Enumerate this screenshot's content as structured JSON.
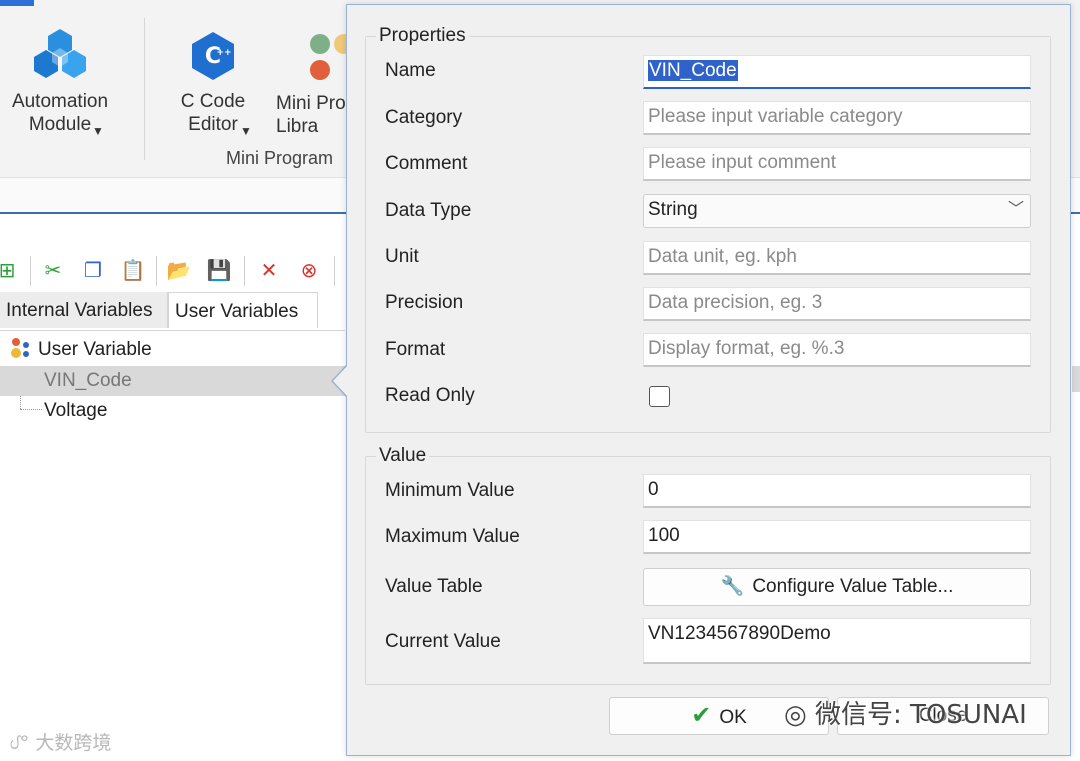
{
  "ribbon": {
    "automation_module_label": "Automation\nModule",
    "c_code_editor_label": "C Code\nEditor",
    "mini_program_library_label": "Mini Pro\nLibra",
    "group_label": "Mini Program",
    "accent_color": "#2f6fd6"
  },
  "toolbar": {
    "icons": [
      "add-icon",
      "cut-icon",
      "copy-icon",
      "paste-icon",
      "import-icon",
      "export-icon",
      "delete-icon",
      "clear-icon"
    ]
  },
  "tabs": [
    {
      "label": "Internal Variables"
    },
    {
      "label": "User Variables"
    }
  ],
  "tree": {
    "root_label": "User Variable",
    "items": [
      {
        "label": "VIN_Code"
      },
      {
        "label": "Voltage"
      }
    ]
  },
  "dialog": {
    "properties_title": "Properties",
    "labels": {
      "name": "Name",
      "category": "Category",
      "comment": "Comment",
      "data_type": "Data Type",
      "unit": "Unit",
      "precision": "Precision",
      "format": "Format",
      "read_only": "Read Only"
    },
    "values": {
      "name": "VIN_Code",
      "data_type": "String"
    },
    "placeholders": {
      "category": "Please input variable category",
      "comment": "Please input comment",
      "unit": "Data unit, eg. kph",
      "precision": "Data precision, eg. 3",
      "format": "Display format, eg. %.3"
    },
    "value_section": {
      "title": "Value",
      "min_label": "Minimum Value",
      "min_value": "0",
      "max_label": "Maximum Value",
      "max_value": "100",
      "table_label": "Value Table",
      "configure_button": "Configure Value Table...",
      "current_label": "Current Value",
      "current_value": "VN1234567890Demo"
    },
    "ok_button": "OK",
    "cancel_button": "Close"
  },
  "watermarks": {
    "left": "大数跨境",
    "right": "微信号: TOSUNAI"
  }
}
